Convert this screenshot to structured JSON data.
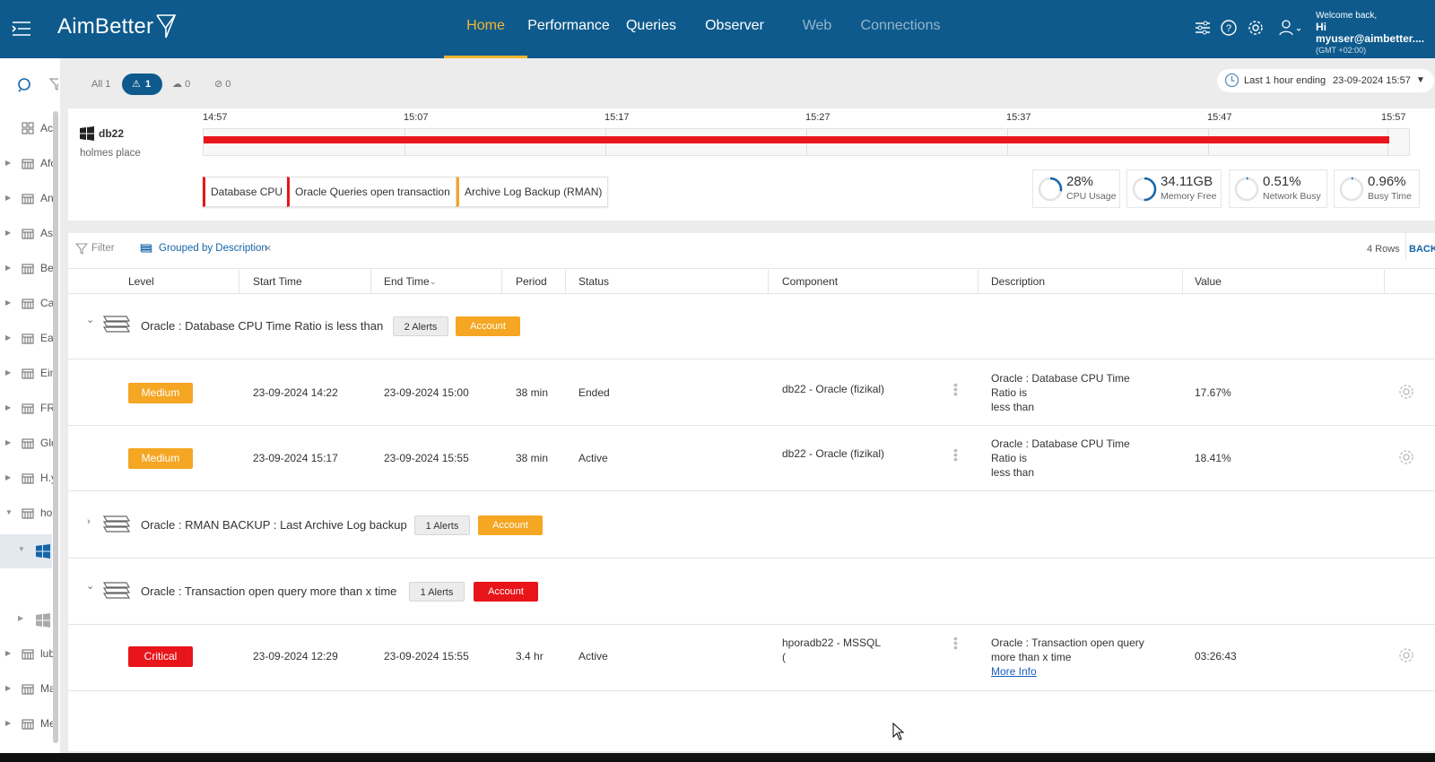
{
  "app": {
    "logo": "AimBetter"
  },
  "nav": [
    {
      "label": "Home",
      "state": "active"
    },
    {
      "label": "Performance",
      "state": "normal"
    },
    {
      "label": "Queries",
      "state": "normal"
    },
    {
      "label": "Observer",
      "state": "normal"
    },
    {
      "label": "Web",
      "state": "dim"
    },
    {
      "label": "Connections",
      "state": "dim"
    }
  ],
  "user": {
    "greeting": "Welcome back,",
    "name": "Hi myuser@aimbetter....",
    "timezone": "(GMT +02:00)"
  },
  "sidebar": {
    "items": [
      {
        "label": "Ac"
      },
      {
        "label": "Afo"
      },
      {
        "label": "An"
      },
      {
        "label": "As"
      },
      {
        "label": "Be"
      },
      {
        "label": "Ca"
      },
      {
        "label": "Eas"
      },
      {
        "label": "Ein"
      },
      {
        "label": "FR"
      },
      {
        "label": "Glo"
      },
      {
        "label": "H.y"
      },
      {
        "label": "hol"
      },
      {
        "label": "lub"
      },
      {
        "label": "Ma"
      },
      {
        "label": "Me"
      }
    ]
  },
  "filters": {
    "all": "All 1",
    "alerts": "1",
    "cloud": "0",
    "checks": "0"
  },
  "time_range": {
    "label": "Last 1 hour ending",
    "value": "23-09-2024 15:57"
  },
  "server": {
    "name": "db22",
    "subtitle": "holmes place"
  },
  "timeline_ticks": [
    "14:57",
    "15:07",
    "15:17",
    "15:27",
    "15:37",
    "15:47",
    "15:57"
  ],
  "component_tags": [
    {
      "label": "Database CPU",
      "color": "#e8151a"
    },
    {
      "label": "Oracle Queries open transaction",
      "color": "#e8151a"
    },
    {
      "label": "Archive Log Backup (RMAN)",
      "color": "#f5a623"
    }
  ],
  "kpis": [
    {
      "value": "28%",
      "label": "CPU Usage",
      "fraction": 0.28
    },
    {
      "value": "34.11GB",
      "label": "Memory Free",
      "fraction": 0.5
    },
    {
      "value": "0.51%",
      "label": "Network Busy",
      "fraction": 0.0051
    },
    {
      "value": "0.96%",
      "label": "Busy Time",
      "fraction": 0.0096
    }
  ],
  "table_toolbar": {
    "filter": "Filter",
    "grouped": "Grouped by Description",
    "rows": "4 Rows",
    "back": "BACK"
  },
  "columns": [
    "Level",
    "Start Time",
    "End Time",
    "Period",
    "Status",
    "Component",
    "Description",
    "Value"
  ],
  "groups": [
    {
      "title": "Oracle : Database CPU Time Ratio is less than",
      "alerts": "2 Alerts",
      "account": "Account",
      "account_color": "#f5a623",
      "expanded": true,
      "rows": [
        {
          "level": "Medium",
          "level_color": "#f5a623",
          "start": "23-09-2024 14:22",
          "end": "23-09-2024 15:00",
          "period": "38 min",
          "status": "Ended",
          "component": "db22 - Oracle (fizikal)",
          "desc1": "Oracle : Database CPU Time Ratio is",
          "desc2": "less than",
          "value": "17.67%"
        },
        {
          "level": "Medium",
          "level_color": "#f5a623",
          "start": "23-09-2024 15:17",
          "end": "23-09-2024 15:55",
          "period": "38 min",
          "status": "Active",
          "component": "db22 - Oracle (fizikal)",
          "desc1": "Oracle : Database CPU Time Ratio is",
          "desc2": "less than",
          "value": "18.41%"
        }
      ]
    },
    {
      "title": "Oracle : RMAN BACKUP : Last Archive Log backup",
      "alerts": "1 Alerts",
      "account": "Account",
      "account_color": "#f5a623",
      "expanded": false
    },
    {
      "title": "Oracle : Transaction open query more than x time",
      "alerts": "1 Alerts",
      "account": "Account",
      "account_color": "#e8151a",
      "expanded": true,
      "rows": [
        {
          "level": "Critical",
          "level_color": "#e8151a",
          "start": "23-09-2024 12:29",
          "end": "23-09-2024 15:55",
          "period": "3.4 hr",
          "status": "Active",
          "component1": "hporadb22 - MSSQL",
          "component2": "(",
          "desc1": "Oracle : Transaction open query",
          "desc2": "more than x time",
          "more": "More Info",
          "value": "03:26:43"
        }
      ]
    }
  ]
}
